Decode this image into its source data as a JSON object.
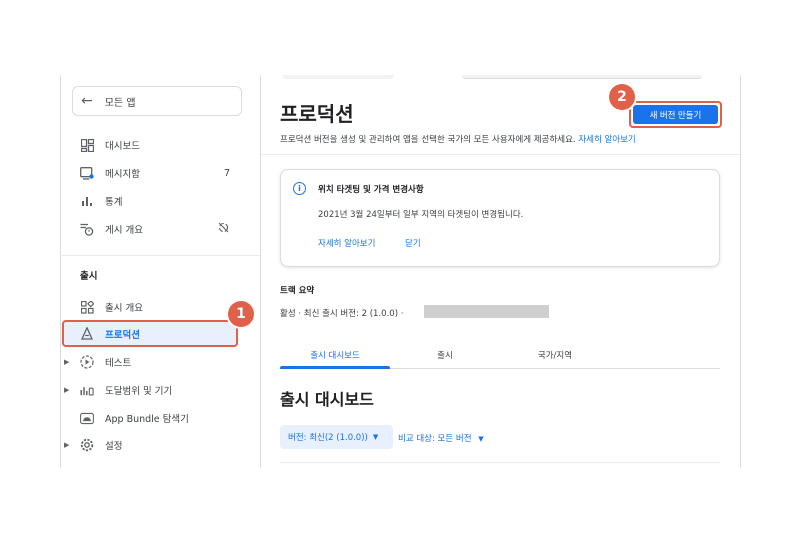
{
  "sidebar": {
    "back_label": "모든 앱",
    "items_top": [
      {
        "label": "대시보드"
      },
      {
        "label": "메시지함",
        "badge": "7"
      },
      {
        "label": "통계"
      },
      {
        "label": "게시 개요"
      }
    ],
    "section_release": "출시",
    "items_release": [
      {
        "label": "출시 개요"
      },
      {
        "label": "프로덕션"
      },
      {
        "label": "테스트"
      },
      {
        "label": "도달범위 및 기기"
      },
      {
        "label": "App Bundle 탐색기"
      },
      {
        "label": "설정"
      }
    ]
  },
  "callouts": {
    "one": "1",
    "two": "2"
  },
  "main": {
    "title": "프로덕션",
    "description": "프로덕션 버전을 생성 및 관리하여 앱을 선택한 국가의 모든 사용자에게 제공하세요.",
    "learn_more": "자세히 알아보기",
    "create_button": "새 버전 만들기",
    "notice": {
      "title": "위치 타겟팅 및 가격 변경사항",
      "body": "2021년 3월 24일부터 일부 지역의 타겟팅이 변경됩니다.",
      "link": "자세히 알아보기",
      "close": "닫기"
    },
    "track_summary_title": "트랙 요약",
    "track_status": "활성 · 최신 출시 버전: 2 (1.0.0) · ",
    "tabs": [
      "출시 대시보드",
      "출시",
      "국가/지역"
    ],
    "section_heading": "출시 대시보드",
    "version_chip": "버전: 최신(2 (1.0.0))",
    "compare_label": "비교 대상: 모든 버전"
  },
  "colors": {
    "accent": "#1a73e8",
    "callout": "#e0604a"
  }
}
